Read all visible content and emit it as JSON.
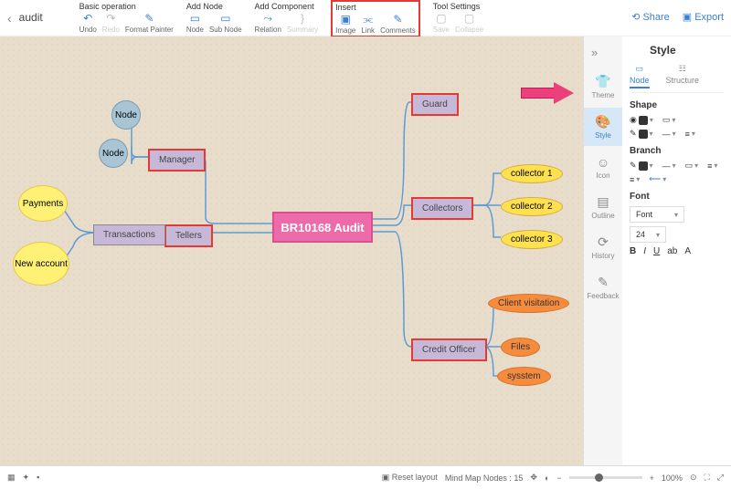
{
  "title": "audit",
  "toolbar": {
    "groups": [
      {
        "name": "Basic operation",
        "items": [
          "Undo",
          "Redo",
          "Format Painter"
        ]
      },
      {
        "name": "Add Node",
        "items": [
          "Node",
          "Sub Node"
        ]
      },
      {
        "name": "Add Component",
        "items": [
          "Relation",
          "Summary"
        ]
      },
      {
        "name": "Insert",
        "items": [
          "Image",
          "Link",
          "Comments"
        ]
      },
      {
        "name": "Tool Settings",
        "items": [
          "Save",
          "Collapse"
        ]
      }
    ],
    "share": "Share",
    "export": "Export"
  },
  "mindmap": {
    "center": "BR10168 Audit",
    "manager": "Manager",
    "node1": "Node",
    "node2": "Node",
    "tellers": "Tellers",
    "transactions": "Transactions",
    "payments": "Payments",
    "newaccount": "New account",
    "guard": "Guard",
    "collectors": "Collectors",
    "c1": "collector 1",
    "c2": "collector 2",
    "c3": "collector 3",
    "credit": "Credit Officer",
    "cv": "Client visitation",
    "files": "Files",
    "sys": "sysstem"
  },
  "sidebar": {
    "title": "Style",
    "tabs": [
      "Theme",
      "Style",
      "Icon",
      "Outline",
      "History",
      "Feedback"
    ],
    "subtabs": [
      "Node",
      "Structure"
    ],
    "shape": "Shape",
    "branch": "Branch",
    "font": "Font",
    "fontSel": "Font",
    "size": "24"
  },
  "bottom": {
    "reset": "Reset layout",
    "nodes_lbl": "Mind Map Nodes :",
    "nodes": "15",
    "zoom": "100%"
  }
}
